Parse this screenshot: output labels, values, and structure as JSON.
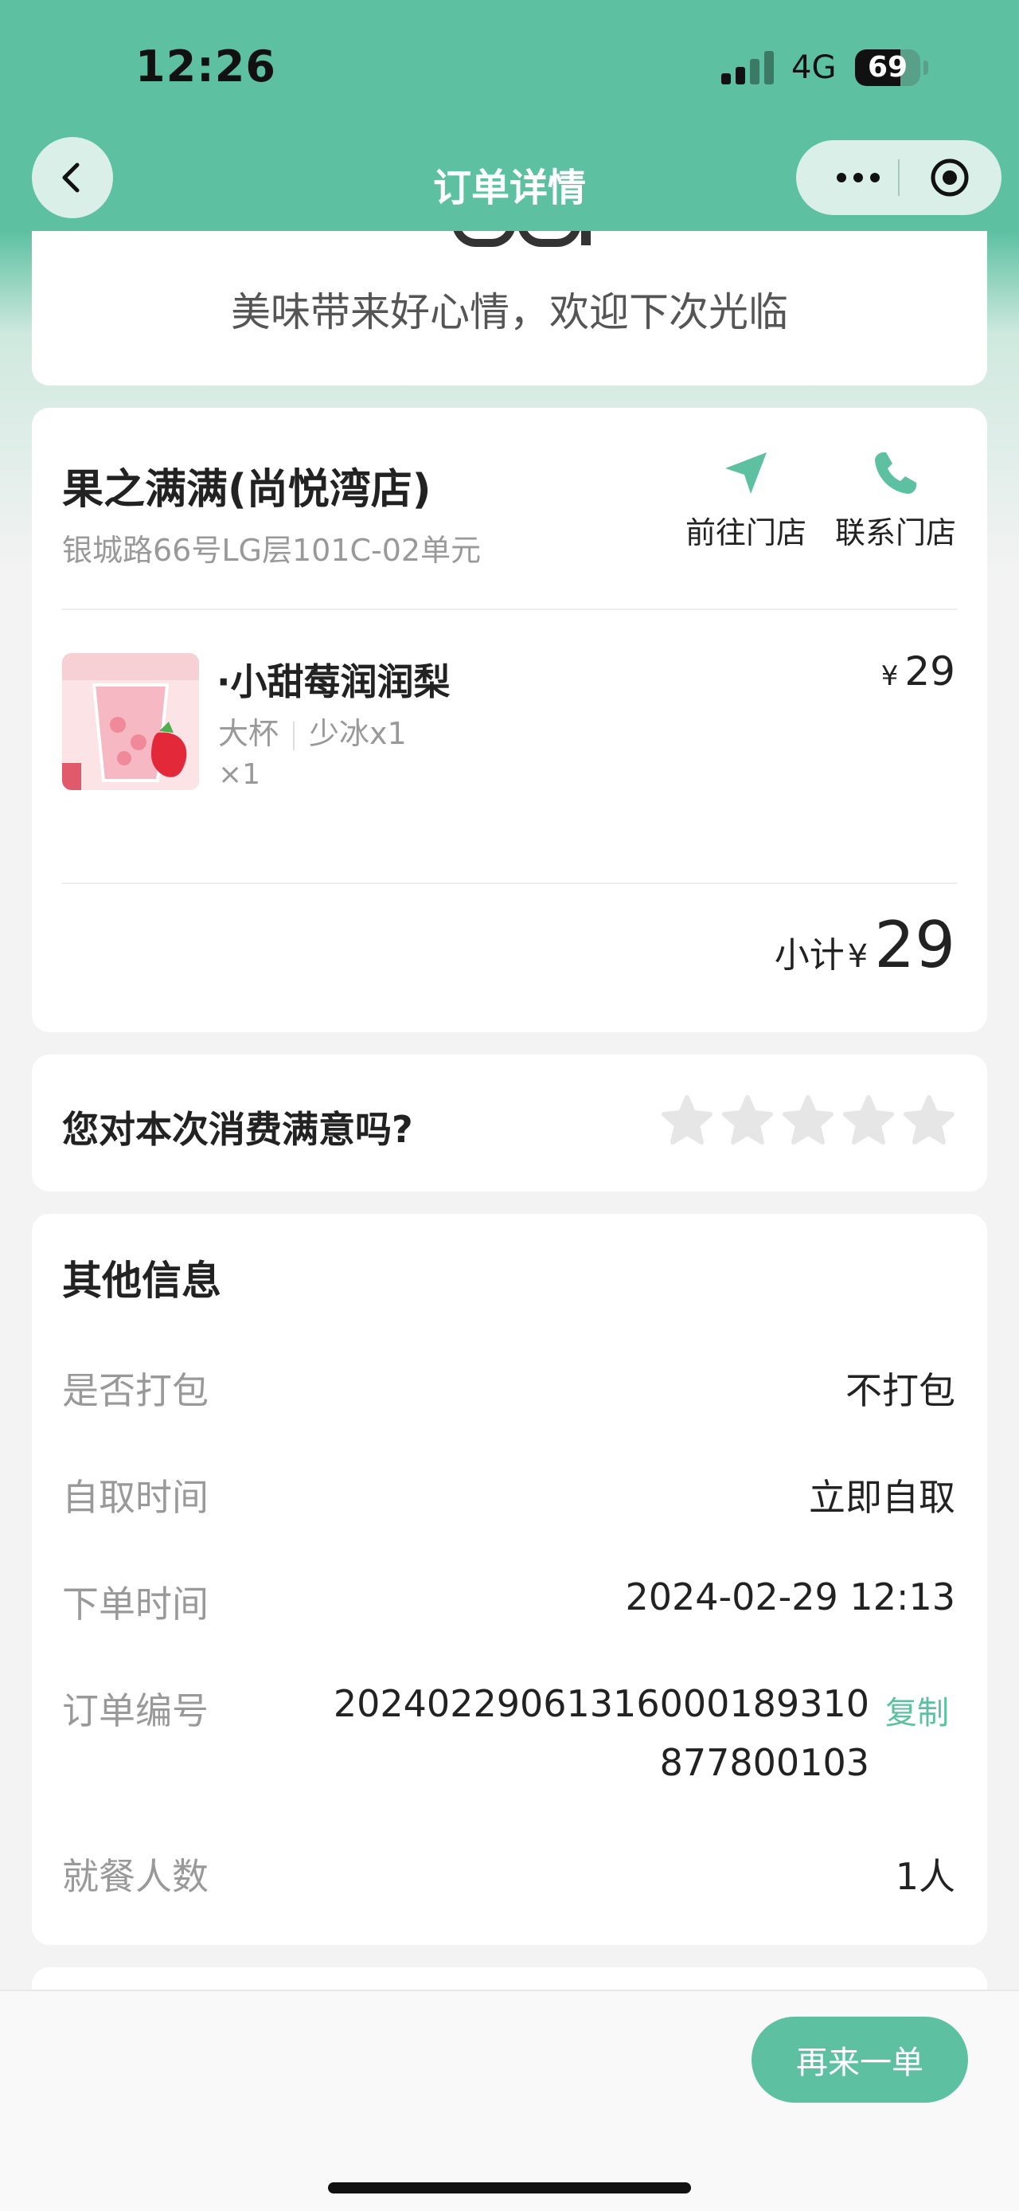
{
  "status_bar": {
    "time": "12:26",
    "network": "4G",
    "battery": "69",
    "battery_level": 0.69
  },
  "nav": {
    "title": "订单详情"
  },
  "welcome": {
    "message": "美味带来好心情，欢迎下次光临"
  },
  "store": {
    "name": "果之满满(尚悦湾店)",
    "address": "银城路66号LG层101C-02单元",
    "go_label": "前往门店",
    "contact_label": "联系门店"
  },
  "product": {
    "name": "·小甜莓润润梨",
    "size": "大杯",
    "ice": "少冰x1",
    "qty": "×1",
    "currency": "¥",
    "price": "29"
  },
  "subtotal": {
    "label": "小计",
    "currency": "¥",
    "amount": "29"
  },
  "rating": {
    "question": "您对本次消费满意吗?",
    "max_stars": 5,
    "selected": 0
  },
  "other_info": {
    "title": "其他信息",
    "rows": [
      {
        "label": "是否打包",
        "value": "不打包"
      },
      {
        "label": "自取时间",
        "value": "立即自取"
      },
      {
        "label": "下单时间",
        "value": "2024-02-29 12:13"
      },
      {
        "label": "订单编号",
        "value_line1": "20240229061316000189310",
        "value_line2": "877800103",
        "action": "复制"
      },
      {
        "label": "就餐人数",
        "value": "1人"
      }
    ]
  },
  "footer": {
    "reorder_label": "再来一单"
  },
  "colors": {
    "brand": "#5dc0a1",
    "muted": "#999999"
  }
}
